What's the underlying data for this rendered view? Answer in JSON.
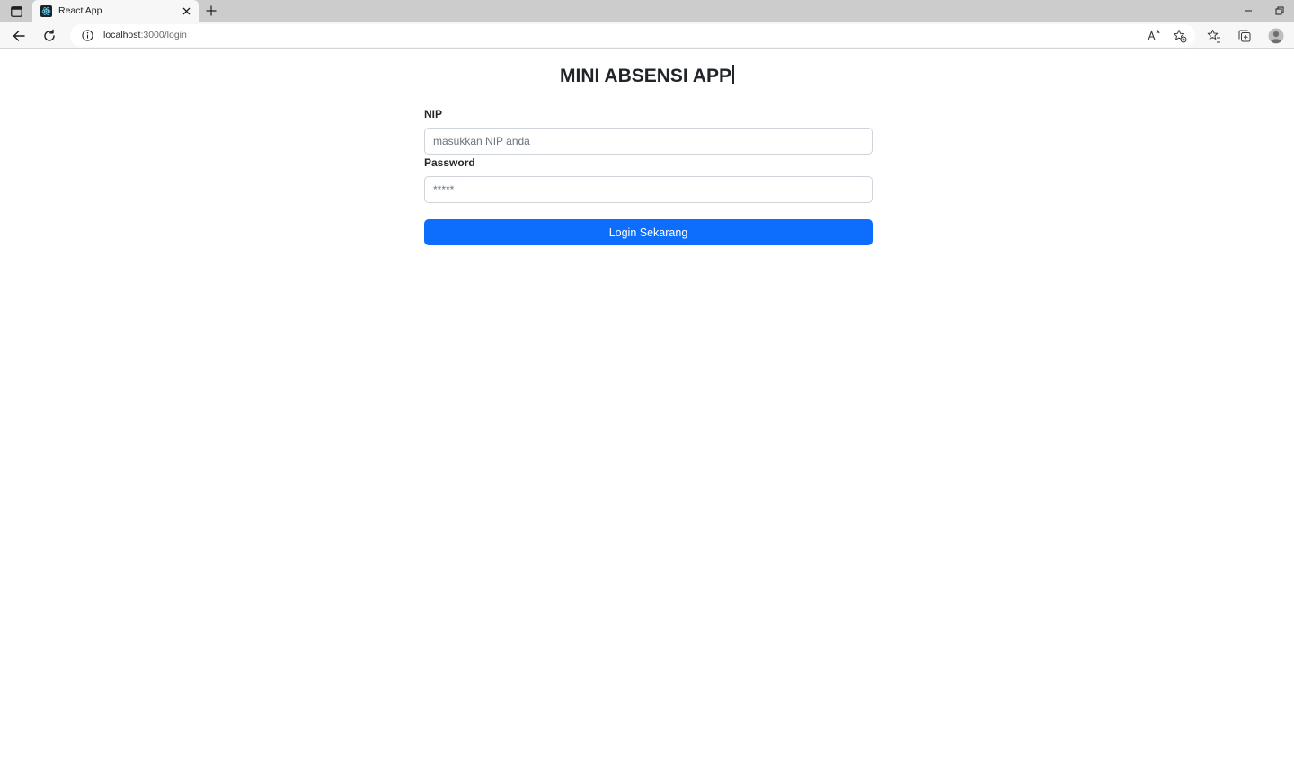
{
  "browser": {
    "tab": {
      "title": "React App"
    },
    "address": {
      "host": "localhost",
      "path": ":3000/login"
    }
  },
  "page": {
    "title": "MINI ABSENSI APP",
    "form": {
      "nip_label": "NIP",
      "nip_placeholder": "masukkan NIP anda",
      "password_label": "Password",
      "password_placeholder": "*****",
      "submit_label": "Login Sekarang"
    }
  },
  "colors": {
    "primary": "#0d6efd",
    "tab_strip": "#cccccc",
    "toolbar": "#f7f7f7",
    "text": "#212529"
  }
}
